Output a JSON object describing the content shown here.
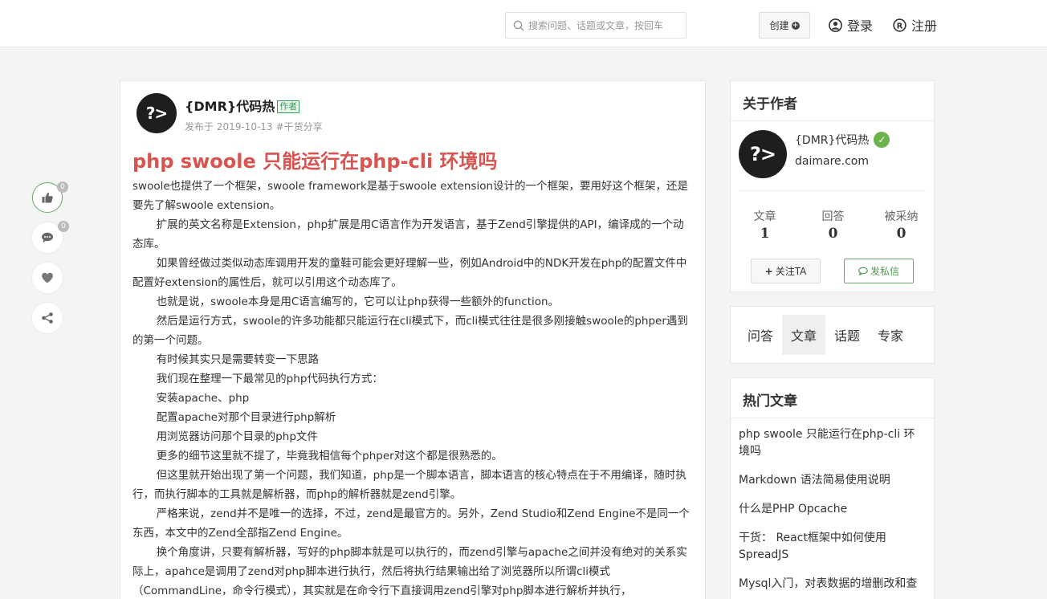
{
  "header": {
    "search_placeholder": "搜索问题、话题或文章，按回车",
    "create_label": "创建",
    "login_label": "登录",
    "register_label": "注册"
  },
  "actions": {
    "like_count": "0",
    "comment_count": "0"
  },
  "article": {
    "author_name": "{DMR}代码热",
    "author_tag": "作者",
    "published": "发布于 2019-10-13",
    "category": "#干货分享",
    "title": "php swoole 只能运行在php-cli 环境吗",
    "paragraphs": [
      {
        "text": "swoole也提供了一个框架，swoole framework是基于swoole extension设计的一个框架，要用好这个框架，还是要先了解swoole extension。",
        "indent": false
      },
      {
        "text": "扩展的英文名称是Extension，php扩展是用C语言作为开发语言，基于Zend引擎提供的API，编译成的一个动态库。",
        "indent": true
      },
      {
        "text": "如果曾经做过类似动态库调用开发的童鞋可能会更好理解一些，例如Android中的NDK开发在php的配置文件中配置好extension的属性后，就可以引用这个动态库了。",
        "indent": true
      },
      {
        "text": "也就是说，swoole本身是用C语言编写的，它可以让php获得一些额外的function。",
        "indent": true
      },
      {
        "text": "然后是运行方式，swoole的许多功能都只能运行在cli模式下，而cli模式往往是很多刚接触swoole的phper遇到的第一个问题。",
        "indent": true
      },
      {
        "text": "有时候其实只是需要转变一下思路",
        "indent": true
      },
      {
        "text": "我们现在整理一下最常见的php代码执行方式：",
        "indent": true
      },
      {
        "text": "安装apache、php",
        "indent": true
      },
      {
        "text": "配置apache对那个目录进行php解析",
        "indent": true
      },
      {
        "text": "用浏览器访问那个目录的php文件",
        "indent": true
      },
      {
        "text": "更多的细节这里就不提了，毕竟我相信每个phper对这个都是很熟悉的。",
        "indent": true
      },
      {
        "text": "但这里就开始出现了第一个问题，我们知道，php是一个脚本语言，脚本语言的核心特点在于不用编译，随时执行，而执行脚本的工具就是解析器，而php的解析器就是zend引擎。",
        "indent": true
      },
      {
        "text": "严格来说，zend并不是唯一的选择，不过，zend是最官方的。另外，Zend Studio和Zend Engine不是同一个东西，本文中的Zend全部指Zend Engine。",
        "indent": true
      },
      {
        "text": "换个角度讲，只要有解析器，写好的php脚本就是可以执行的，而zend引擎与apache之间并没有绝对的关系实际上，apahce是调用了zend对php脚本进行执行，然后将执行结果输出给了浏览器所以所谓cli模式（CommandLine，命令行模式），其实就是在命令行下直接调用zend引擎对php脚本进行解析并执行，",
        "indent": true
      }
    ]
  },
  "about_author": {
    "heading": "关于作者",
    "name": "{DMR}代码热",
    "site": "daimare.com",
    "stats": [
      {
        "label": "文章",
        "value": "1"
      },
      {
        "label": "回答",
        "value": "0"
      },
      {
        "label": "被采纳",
        "value": "0"
      }
    ],
    "follow_label": "关注TA",
    "message_label": "发私信"
  },
  "tabs": [
    {
      "label": "问答",
      "active": false
    },
    {
      "label": "文章",
      "active": true
    },
    {
      "label": "话题",
      "active": false
    },
    {
      "label": "专家",
      "active": false
    }
  ],
  "hot": {
    "heading": "热门文章",
    "items": [
      "php swoole 只能运行在php-cli 环境吗",
      "Markdown 语法简易使用说明",
      "什么是PHP Opcache",
      "干货： React框架中如何使用SpreadJS",
      "Mysql入门，对表数据的增删改和查"
    ]
  },
  "colors": {
    "title": "#d9534f",
    "accent_green": "#6aa86a",
    "verify_green": "#6bb34a"
  },
  "icons": {
    "avatar": "?>"
  }
}
